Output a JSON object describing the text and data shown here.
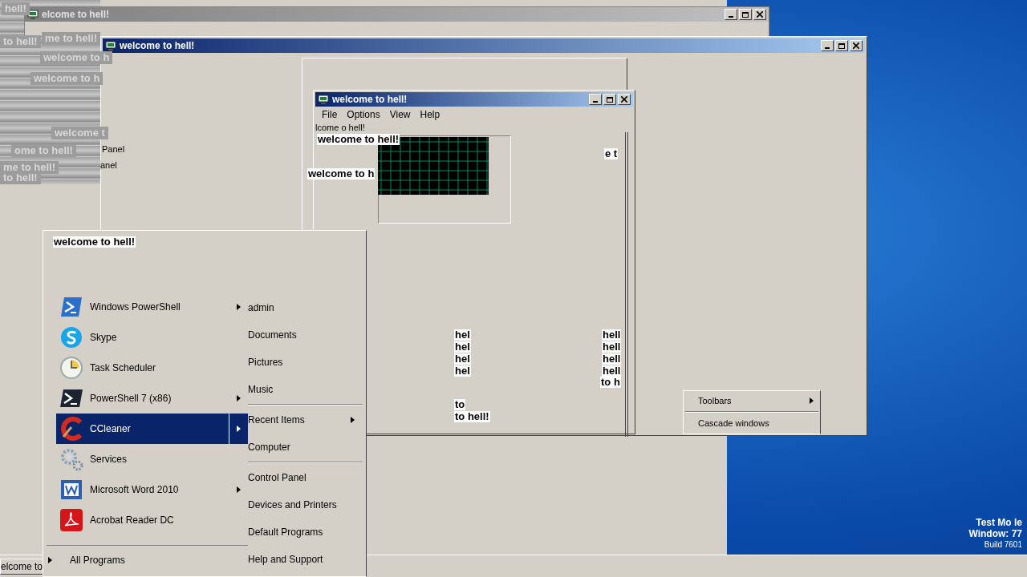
{
  "windows": [
    {
      "title": "elcome to hell!",
      "active": false
    },
    {
      "title": "welcome to hell!",
      "active": true
    }
  ],
  "front_window": {
    "title": "welcome to hell!",
    "active": true,
    "menu": [
      "File",
      "Options",
      "View",
      "Help"
    ]
  },
  "glitch_texts": [
    {
      "text": "hell!",
      "kind": "faded"
    },
    {
      "text": "to hell!",
      "kind": "faded"
    },
    {
      "text": "me to hell!",
      "kind": "faded"
    },
    {
      "text": "welcome to h",
      "kind": "faded"
    },
    {
      "text": "welcome to h",
      "kind": "faded"
    },
    {
      "text": "welcome t",
      "kind": "faded"
    },
    {
      "text": "ome to hell!",
      "kind": "faded"
    },
    {
      "text": "me to hell!",
      "kind": "faded"
    },
    {
      "text": "to hell!",
      "kind": "faded"
    },
    {
      "text": "Panel",
      "kind": "plain"
    },
    {
      "text": "anel",
      "kind": "plain"
    },
    {
      "text": "lcome  o  hell!",
      "kind": "plain"
    },
    {
      "text": "welcome to hell!",
      "kind": "bold"
    },
    {
      "text": "welcome to h",
      "kind": "bold"
    },
    {
      "text": "e t",
      "kind": "bold"
    },
    {
      "text": "hel",
      "kind": "bold"
    },
    {
      "text": "hel",
      "kind": "bold"
    },
    {
      "text": "hel",
      "kind": "bold"
    },
    {
      "text": "hel",
      "kind": "bold"
    },
    {
      "text": "hell",
      "kind": "bold"
    },
    {
      "text": "hell",
      "kind": "bold"
    },
    {
      "text": "hell",
      "kind": "bold"
    },
    {
      "text": "hell",
      "kind": "bold"
    },
    {
      "text": "to h",
      "kind": "bold"
    },
    {
      "text": "to",
      "kind": "bold"
    },
    {
      "text": "to hell!",
      "kind": "bold"
    },
    {
      "text": "welcome to hell!",
      "kind": "bold"
    }
  ],
  "start_menu": {
    "programs": [
      {
        "label": "Windows PowerShell",
        "has_submenu": true,
        "selected": false
      },
      {
        "label": "Skype",
        "has_submenu": false,
        "selected": false
      },
      {
        "label": "Task Scheduler",
        "has_submenu": false,
        "selected": false
      },
      {
        "label": "PowerShell 7 (x86)",
        "has_submenu": true,
        "selected": false
      },
      {
        "label": "CCleaner",
        "has_submenu": true,
        "selected": true
      },
      {
        "label": "Services",
        "has_submenu": false,
        "selected": false
      },
      {
        "label": "Microsoft Word 2010",
        "has_submenu": true,
        "selected": false
      },
      {
        "label": "Acrobat Reader DC",
        "has_submenu": false,
        "selected": false
      }
    ],
    "all_programs": "All Programs",
    "places": [
      {
        "kind": "item",
        "label": "admin",
        "has_submenu": false
      },
      {
        "kind": "item",
        "label": "Documents",
        "has_submenu": false
      },
      {
        "kind": "item",
        "label": "Pictures",
        "has_submenu": false
      },
      {
        "kind": "item",
        "label": "Music",
        "has_submenu": false
      },
      {
        "kind": "separator"
      },
      {
        "kind": "item",
        "label": "Recent Items",
        "has_submenu": true
      },
      {
        "kind": "item",
        "label": "Computer",
        "has_submenu": false
      },
      {
        "kind": "separator"
      },
      {
        "kind": "item",
        "label": "Control Panel",
        "has_submenu": false
      },
      {
        "kind": "item",
        "label": "Devices and Printers",
        "has_submenu": false
      },
      {
        "kind": "item",
        "label": "Default Programs",
        "has_submenu": false
      },
      {
        "kind": "item",
        "label": "Help and Support",
        "has_submenu": false
      }
    ]
  },
  "context_menu": [
    {
      "kind": "item",
      "label": "Toolbars",
      "has_submenu": true
    },
    {
      "kind": "separator"
    },
    {
      "kind": "item",
      "label": "Cascade windows",
      "has_submenu": false
    }
  ],
  "desktop_info": [
    "Test Mo le",
    "Window: 77",
    "Build 7601"
  ],
  "taskbar": {
    "buttons": [
      "elcome to"
    ]
  }
}
